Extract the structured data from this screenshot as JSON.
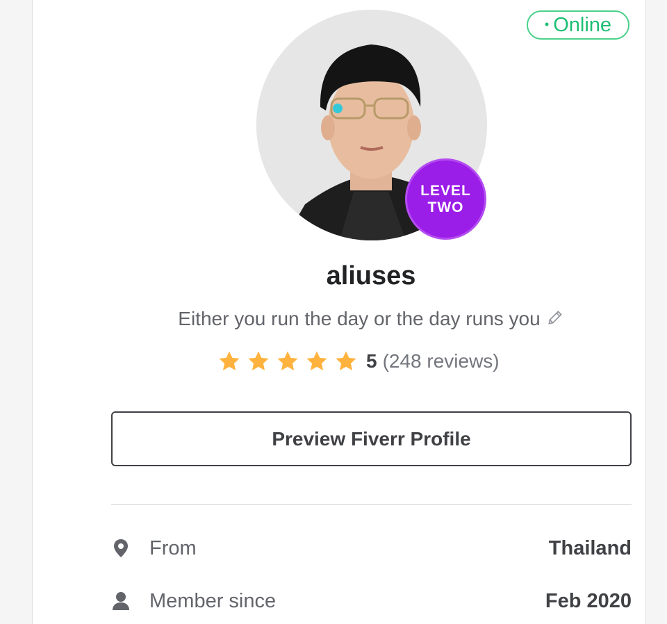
{
  "status": {
    "label": "Online",
    "color": "#1dbf73"
  },
  "profile": {
    "username": "aliuses",
    "tagline": "Either you run the day or the day runs you",
    "level_line1": "LEVEL",
    "level_line2": "TWO",
    "level_color": "#9b1de8"
  },
  "rating": {
    "stars": 5,
    "score": "5",
    "reviews": "(248 reviews)",
    "star_color": "#ffb33e"
  },
  "actions": {
    "preview_label": "Preview Fiverr Profile"
  },
  "info": {
    "from_label": "From",
    "from_value": "Thailand",
    "member_label": "Member since",
    "member_value": "Feb 2020"
  },
  "icons": {
    "online_dot": "dot-icon",
    "edit": "pencil-icon",
    "location": "location-pin-icon",
    "member": "user-icon"
  }
}
